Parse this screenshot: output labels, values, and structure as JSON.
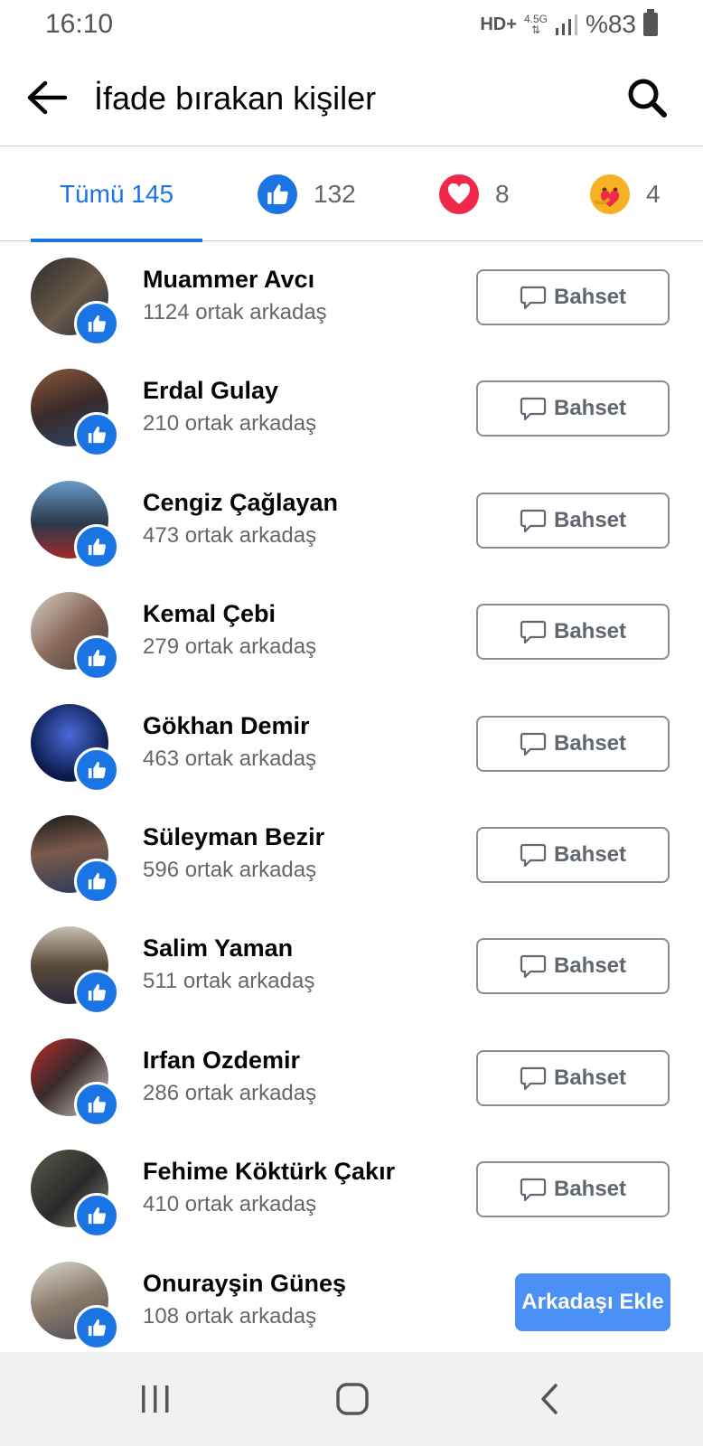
{
  "status_bar": {
    "time": "16:10",
    "network": "HD+",
    "network_type": "4.5G",
    "battery": "%83"
  },
  "header": {
    "title": "İfade bırakan kişiler"
  },
  "tabs": {
    "all_label": "Tümü 145",
    "like_count": "132",
    "love_count": "8",
    "care_count": "4"
  },
  "colors": {
    "accent": "#1b74e4",
    "love": "#f0284a",
    "care": "#f7b125"
  },
  "people": [
    {
      "name": "Muammer Avcı",
      "mutual": "1124 ortak arkadaş",
      "action": "Bahset"
    },
    {
      "name": "Erdal Gulay",
      "mutual": "210 ortak arkadaş",
      "action": "Bahset"
    },
    {
      "name": "Cengiz Çağlayan",
      "mutual": "473 ortak arkadaş",
      "action": "Bahset"
    },
    {
      "name": "Kemal Çebi",
      "mutual": "279 ortak arkadaş",
      "action": "Bahset"
    },
    {
      "name": "Gökhan Demir",
      "mutual": "463 ortak arkadaş",
      "action": "Bahset"
    },
    {
      "name": "Süleyman Bezir",
      "mutual": "596 ortak arkadaş",
      "action": "Bahset"
    },
    {
      "name": "Salim Yaman",
      "mutual": "511 ortak arkadaş",
      "action": "Bahset"
    },
    {
      "name": "Irfan Ozdemir",
      "mutual": "286 ortak arkadaş",
      "action": "Bahset"
    },
    {
      "name": "Fehime Köktürk Çakır",
      "mutual": "410 ortak arkadaş",
      "action": "Bahset"
    },
    {
      "name": "Onurayşin Güneş",
      "mutual": "108 ortak arkadaş",
      "action": "Arkadaşı Ekle"
    }
  ]
}
